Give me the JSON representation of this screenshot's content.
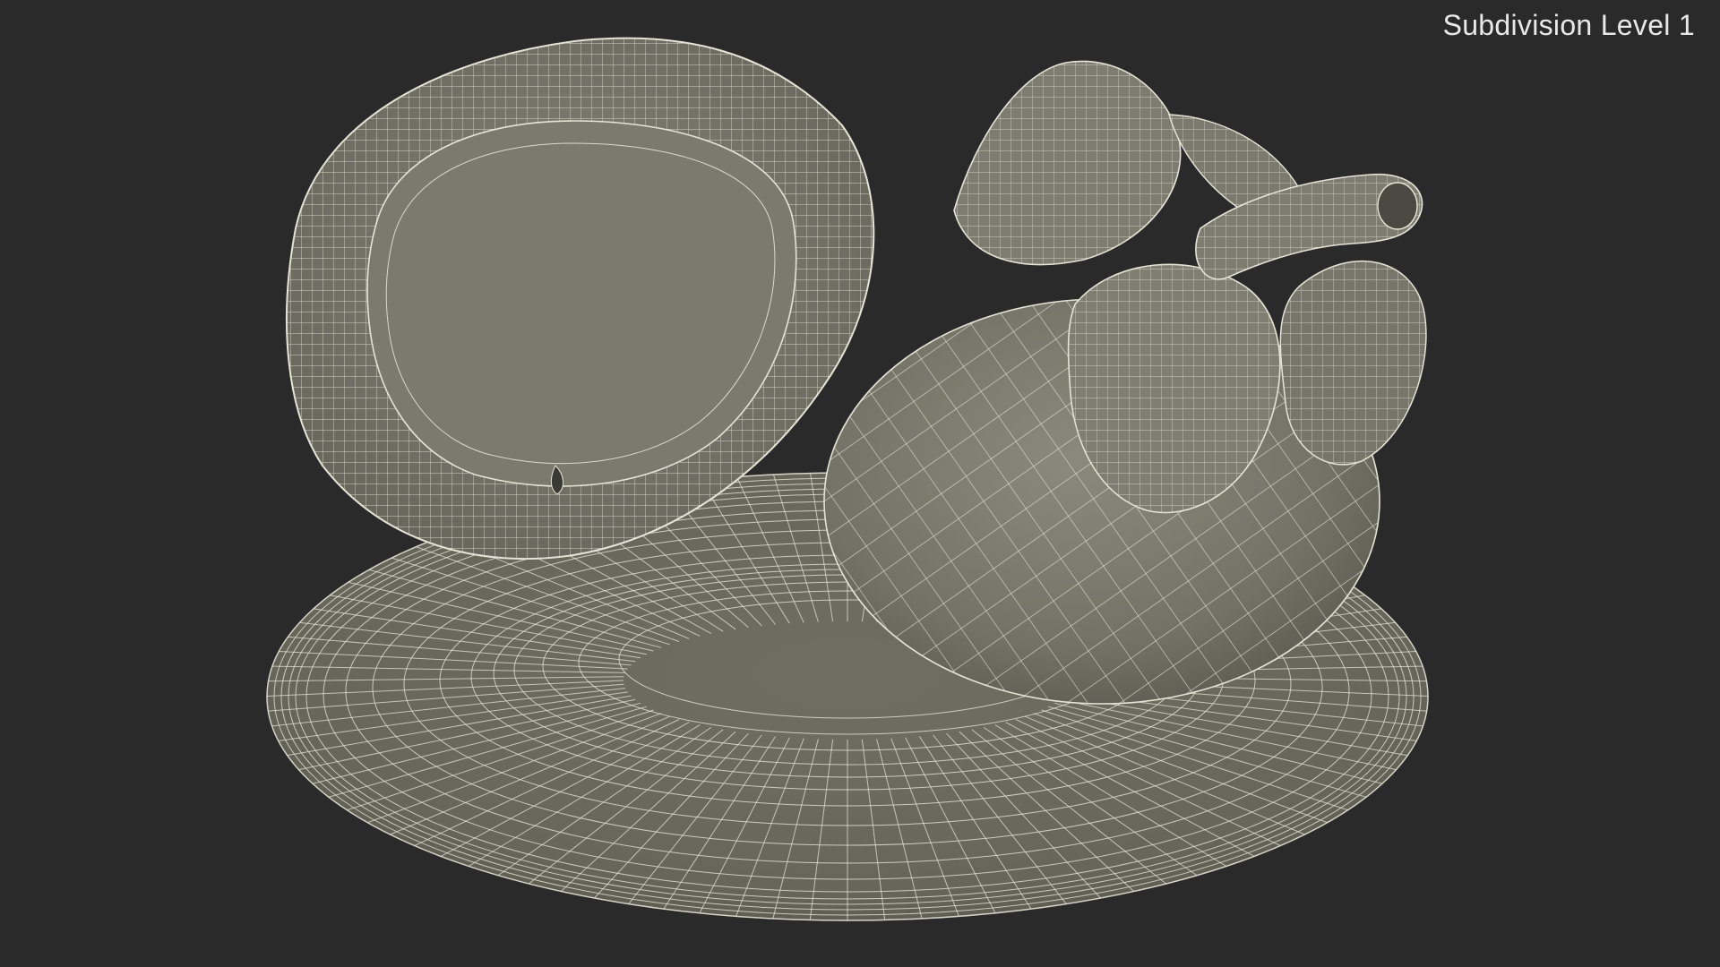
{
  "viewport": {
    "label": "Subdivision Level 1",
    "background_color": "#2a2a2a",
    "mesh_fill_color": "#767668",
    "wire_color": "#e4e4d6"
  },
  "objects": [
    {
      "name": "plate",
      "icon": "plate-wireframe"
    },
    {
      "name": "fruit-half-cut",
      "icon": "fruit-half-wireframe"
    },
    {
      "name": "fruit-whole",
      "icon": "fruit-whole-wireframe"
    },
    {
      "name": "fruit-sepal-leaves",
      "icon": "leaf-wireframe"
    },
    {
      "name": "fruit-stem",
      "icon": "stem-wireframe"
    }
  ]
}
